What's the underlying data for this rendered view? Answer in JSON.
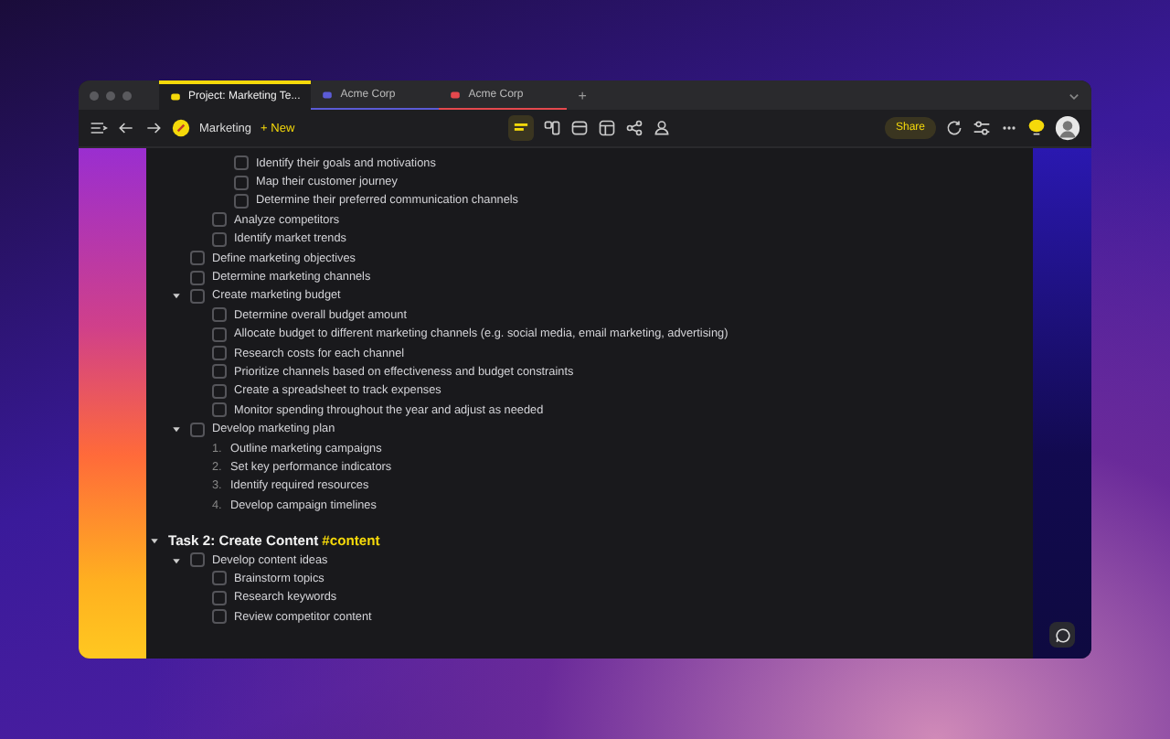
{
  "tabs": [
    {
      "label": "Project: Marketing Te...",
      "selected": true,
      "color": "#f5d90a"
    },
    {
      "label": "Acme Corp",
      "selected": false,
      "color": "#5b5bd6"
    },
    {
      "label": "Acme Corp",
      "selected": false,
      "color": "#e5484d"
    }
  ],
  "new_tab": "+",
  "toolbar": {
    "page": "Marketing",
    "new_button": "+ New",
    "share_button": "Share"
  },
  "outline": [
    {
      "kind": "group",
      "children": [
        {
          "kind": "group",
          "children": [
            {
              "kind": "group",
              "children": [
                {
                  "kind": "task",
                  "text": "Identify their goals and motivations",
                  "checked": false
                },
                {
                  "kind": "task",
                  "text": "Map their customer journey",
                  "checked": false
                },
                {
                  "kind": "task",
                  "text": "Determine their preferred communication channels",
                  "checked": false
                }
              ]
            },
            {
              "kind": "task",
              "text": "Analyze competitors",
              "checked": false
            },
            {
              "kind": "task",
              "text": "Identify market trends",
              "checked": false
            }
          ]
        },
        {
          "kind": "task",
          "text": "Define marketing objectives",
          "checked": false
        },
        {
          "kind": "task",
          "text": "Determine marketing channels",
          "checked": false
        },
        {
          "kind": "task",
          "text": "Create marketing budget",
          "checked": false,
          "expanded": true,
          "children": [
            {
              "kind": "task",
              "text": "Determine overall budget amount",
              "checked": false
            },
            {
              "kind": "task",
              "text": "Allocate budget to different marketing channels (e.g. social media, email marketing, advertising)",
              "checked": false
            },
            {
              "kind": "task",
              "text": "Research costs for each channel",
              "checked": false
            },
            {
              "kind": "task",
              "text": "Prioritize channels based on effectiveness and budget constraints",
              "checked": false
            },
            {
              "kind": "task",
              "text": "Create a spreadsheet to track expenses",
              "checked": false
            },
            {
              "kind": "task",
              "text": "Monitor spending throughout the year and adjust as needed",
              "checked": false
            }
          ]
        },
        {
          "kind": "task",
          "text": "Develop marketing plan",
          "checked": false,
          "expanded": true,
          "children": [
            {
              "kind": "numbered",
              "number": "1.",
              "text": "Outline marketing campaigns"
            },
            {
              "kind": "numbered",
              "number": "2.",
              "text": "Set key performance indicators"
            },
            {
              "kind": "numbered",
              "number": "3.",
              "text": "Identify required resources"
            },
            {
              "kind": "numbered",
              "number": "4.",
              "text": "Develop campaign timelines"
            }
          ]
        }
      ]
    },
    {
      "kind": "heading",
      "text": "Task 2: Create Content",
      "tag": "#content",
      "expanded": true,
      "children": [
        {
          "kind": "task",
          "text": "Develop content ideas",
          "checked": false,
          "expanded": true,
          "children": [
            {
              "kind": "task",
              "text": "Brainstorm topics",
              "checked": false
            },
            {
              "kind": "task",
              "text": "Research keywords",
              "checked": false
            },
            {
              "kind": "task",
              "text": "Review competitor content",
              "checked": false
            }
          ]
        }
      ]
    }
  ]
}
